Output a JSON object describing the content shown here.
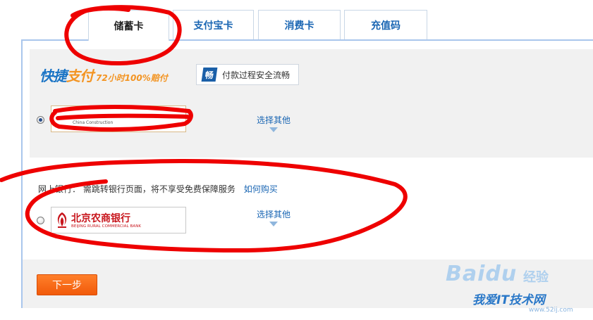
{
  "tabs": [
    {
      "label": "储蓄卡",
      "active": true
    },
    {
      "label": "支付宝卡",
      "active": false
    },
    {
      "label": "消费卡",
      "active": false
    },
    {
      "label": "充值码",
      "active": false
    }
  ],
  "quick_pay": {
    "logo_main": "快捷",
    "logo_pay": "支付",
    "logo_tag": "72小时100%赔付",
    "smooth_badge": "畅",
    "smooth_text": "付款过程安全流畅",
    "bank_text": "China Construction",
    "choose_other": "选择其他",
    "selected": true
  },
  "online_bank": {
    "label": "网上银行：",
    "notice": "需跳转银行页面，将不享受免费保障服务",
    "how_to_buy": "如何购买",
    "bank_name_cn": "北京农商银行",
    "bank_name_en": "BEIJING RURAL COMMERCIAL BANK",
    "choose_other": "选择其他",
    "selected": false
  },
  "footer": {
    "next_label": "下一步"
  },
  "watermark": {
    "brand": "Baidu",
    "product": "经验",
    "site": "我爱IT技术网",
    "url": "www.52ij.com"
  },
  "colors": {
    "link": "#1a66b3",
    "next_button": "#f15a0a",
    "panel_border": "#a9c6ec",
    "annotation": "#ee0000"
  }
}
